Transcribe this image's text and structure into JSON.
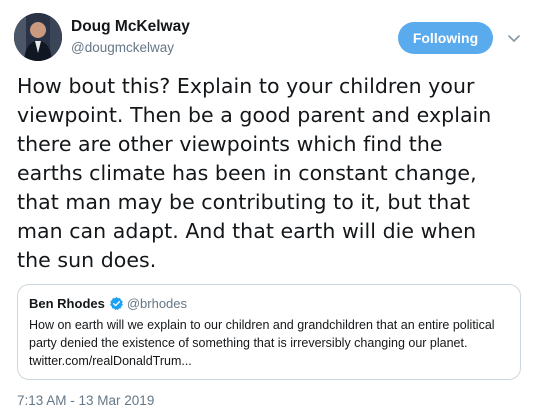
{
  "author": {
    "display_name": "Doug McKelway",
    "handle": "@dougmckelway"
  },
  "follow_button": {
    "label": "Following",
    "color": "#5aaaee"
  },
  "menu": {
    "icon": "chevron-down-icon"
  },
  "tweet": {
    "lines": [
      "How bout this? Explain to your children your",
      "viewpoint. Then be a good parent and explain",
      "there are other viewpoints which find the",
      "earths climate has been in constant change,",
      "that man may be contributing to it, but that",
      "man can adapt. And that earth will die when",
      "the sun does."
    ],
    "timestamp": "7:13 AM - 13 Mar 2019"
  },
  "quoted_tweet": {
    "display_name": "Ben Rhodes",
    "verified_icon": "verified-badge-icon",
    "handle": "@brhodes",
    "lines": [
      "How on earth will we explain to our children and grandchildren that an entire political",
      "party denied the existence of something that is irreversibly changing our planet.",
      "twitter.com/realDonaldTrum..."
    ]
  }
}
